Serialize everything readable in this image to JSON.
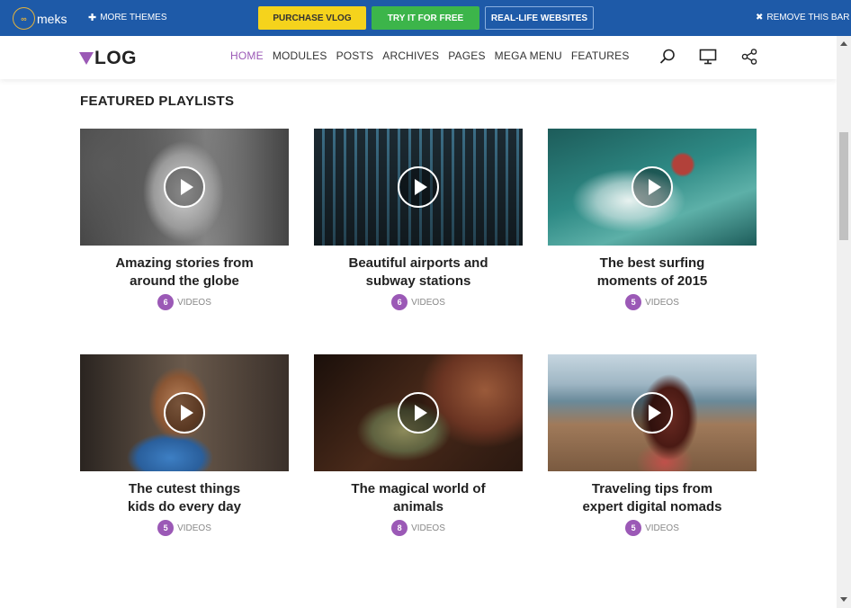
{
  "topbar": {
    "logo_text": "meks",
    "more_themes": "MORE THEMES",
    "purchase": "PURCHASE VLOG",
    "try_free": "TRY IT FOR FREE",
    "real_life": "REAL-LIFE WEBSITES",
    "remove": "REMOVE THIS BAR"
  },
  "header": {
    "logo": "LOG",
    "nav": [
      "HOME",
      "MODULES",
      "POSTS",
      "ARCHIVES",
      "PAGES",
      "MEGA MENU",
      "FEATURES"
    ]
  },
  "section": {
    "title": "FEATURED PLAYLISTS"
  },
  "playlists": [
    {
      "title": "Amazing stories from around the globe",
      "count": "6",
      "label": "VIDEOS"
    },
    {
      "title": "Beautiful airports and subway stations",
      "count": "6",
      "label": "VIDEOS"
    },
    {
      "title": "The best surfing moments of 2015",
      "count": "5",
      "label": "VIDEOS"
    },
    {
      "title": "The cutest things kids do every day",
      "count": "5",
      "label": "VIDEOS"
    },
    {
      "title": "The magical world of animals",
      "count": "8",
      "label": "VIDEOS"
    },
    {
      "title": "Traveling tips from expert digital nomads",
      "count": "5",
      "label": "VIDEOS"
    }
  ],
  "colors": {
    "brand": "#9b59b6",
    "topbar": "#1e5aa8",
    "purchase": "#f5d31c",
    "try": "#3cb54a"
  }
}
